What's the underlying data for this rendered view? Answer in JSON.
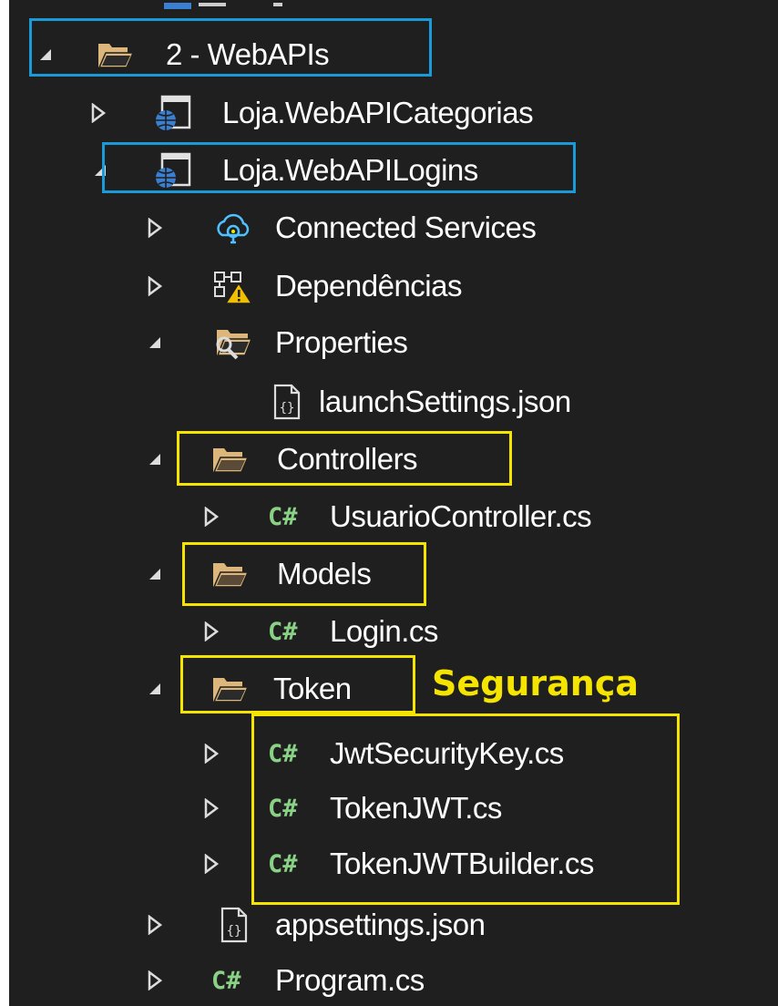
{
  "tree": {
    "folder_webapis": "2 - WebAPIs",
    "project_categorias": "Loja.WebAPICategorias",
    "project_logins": "Loja.WebAPILogins",
    "connected_services": "Connected Services",
    "dependencias": "Dependências",
    "properties": "Properties",
    "launch_settings": "launchSettings.json",
    "controllers": "Controllers",
    "usuario_controller": "UsuarioController.cs",
    "models": "Models",
    "login_cs": "Login.cs",
    "token": "Token",
    "jwt_security_key": "JwtSecurityKey.cs",
    "token_jwt": "TokenJWT.cs",
    "token_jwt_builder": "TokenJWTBuilder.cs",
    "appsettings": "appsettings.json",
    "program": "Program.cs"
  },
  "csharp_glyph": "C#",
  "annotation": "Segurança",
  "colors": {
    "background": "#1f1f1f",
    "text": "#ffffff",
    "highlight_blue": "#1a9bd7",
    "highlight_yellow": "#f5e400",
    "csharp": "#89d185",
    "folder": "#dcb67a"
  }
}
